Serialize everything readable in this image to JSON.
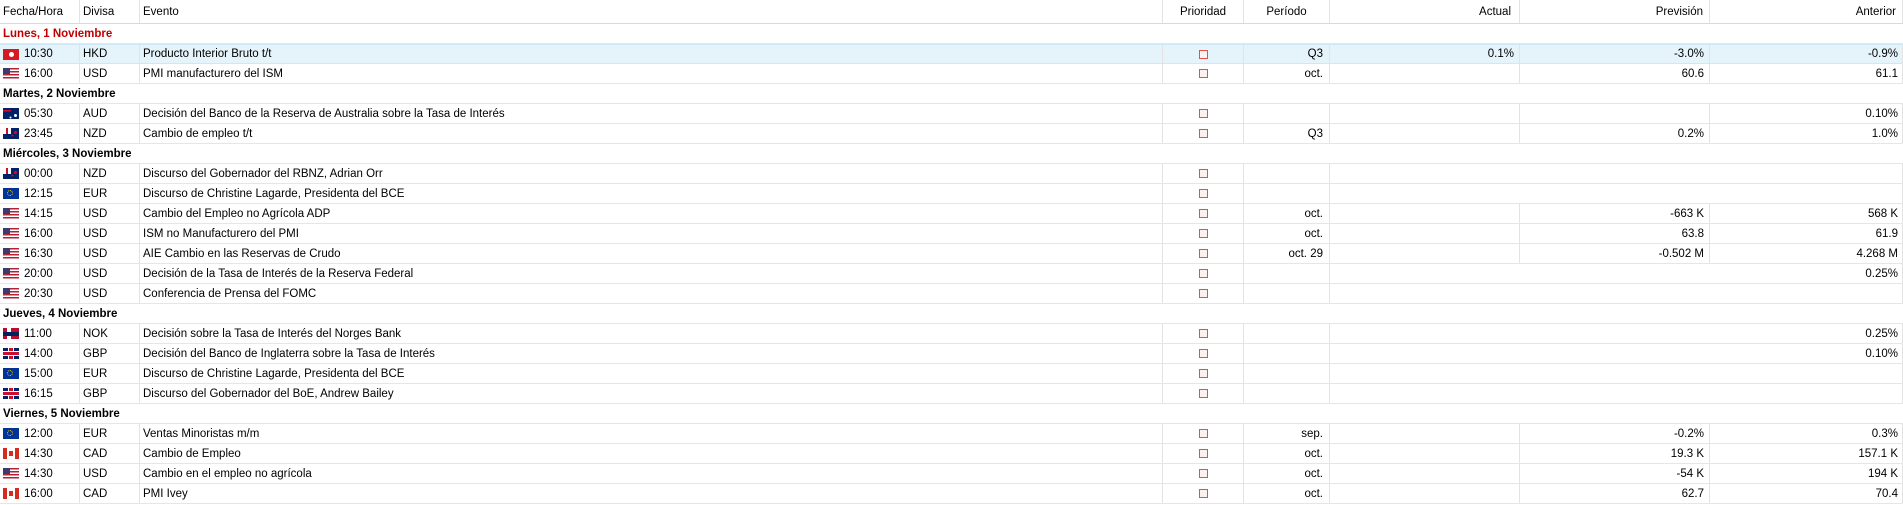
{
  "colors": {
    "day_header": "#c00000",
    "selected_row": "#e5f3fb",
    "priority_box": "#d9534f"
  },
  "columns": {
    "time": "Fecha/Hora",
    "currency": "Divisa",
    "event": "Evento",
    "priority": "Prioridad",
    "period": "Período",
    "actual": "Actual",
    "forecast": "Previsión",
    "previous": "Anterior"
  },
  "days": [
    {
      "label": "Lunes, 1 Noviembre",
      "highlight": true,
      "events": [
        {
          "flag": "hk",
          "time": "10:30",
          "currency": "HKD",
          "event": "Producto Interior Bruto t/t",
          "period": "Q3",
          "actual": "0.1%",
          "forecast": "-3.0%",
          "previous": "-0.9%",
          "selected": true,
          "cells": 5
        },
        {
          "flag": "us",
          "time": "16:00",
          "currency": "USD",
          "event": "PMI manufacturero del ISM",
          "period": "oct.",
          "actual": "",
          "forecast": "60.6",
          "previous": "61.1",
          "cells": 5
        }
      ]
    },
    {
      "label": "Martes, 2 Noviembre",
      "events": [
        {
          "flag": "au",
          "time": "05:30",
          "currency": "AUD",
          "event": "Decisión del Banco de la Reserva de Australia sobre la Tasa de Interés",
          "period": "",
          "actual": "",
          "forecast": "",
          "previous": "0.10%",
          "cells": 5
        },
        {
          "flag": "nz",
          "time": "23:45",
          "currency": "NZD",
          "event": "Cambio de empleo t/t",
          "period": "Q3",
          "actual": "",
          "forecast": "0.2%",
          "previous": "1.0%",
          "cells": 5
        }
      ]
    },
    {
      "label": "Miércoles, 3 Noviembre",
      "events": [
        {
          "flag": "nz",
          "time": "00:00",
          "currency": "NZD",
          "event": "Discurso del Gobernador del RBNZ, Adrian Orr",
          "period": "",
          "actual": "",
          "forecast": "",
          "previous": "",
          "cells": 3
        },
        {
          "flag": "eu",
          "time": "12:15",
          "currency": "EUR",
          "event": "Discurso de Christine Lagarde, Presidenta del BCE",
          "period": "",
          "actual": "",
          "forecast": "",
          "previous": "",
          "cells": 3
        },
        {
          "flag": "us",
          "time": "14:15",
          "currency": "USD",
          "event": "Cambio del Empleo no Agrícola ADP",
          "period": "oct.",
          "actual": "",
          "forecast": "-663 K",
          "previous": "568 K",
          "cells": 5
        },
        {
          "flag": "us",
          "time": "16:00",
          "currency": "USD",
          "event": "ISM no Manufacturero del PMI",
          "period": "oct.",
          "actual": "",
          "forecast": "63.8",
          "previous": "61.9",
          "cells": 5
        },
        {
          "flag": "us",
          "time": "16:30",
          "currency": "USD",
          "event": "AIE Cambio en las Reservas de Crudo",
          "period": "oct. 29",
          "actual": "",
          "forecast": "-0.502 M",
          "previous": "4.268 M",
          "cells": 5
        },
        {
          "flag": "us",
          "time": "20:00",
          "currency": "USD",
          "event": "Decisión de la Tasa de Interés de la Reserva Federal",
          "period": "",
          "actual": "",
          "forecast": "",
          "previous": "0.25%",
          "cells": 4
        },
        {
          "flag": "us",
          "time": "20:30",
          "currency": "USD",
          "event": "Conferencia de Prensa del FOMC",
          "period": "",
          "actual": "",
          "forecast": "",
          "previous": "",
          "cells": 3
        }
      ]
    },
    {
      "label": "Jueves, 4 Noviembre",
      "events": [
        {
          "flag": "no",
          "time": "11:00",
          "currency": "NOK",
          "event": "Decisión sobre la Tasa de Interés del Norges Bank",
          "period": "",
          "actual": "",
          "forecast": "",
          "previous": "0.25%",
          "cells": 4
        },
        {
          "flag": "gb",
          "time": "14:00",
          "currency": "GBP",
          "event": "Decisión del Banco de Inglaterra sobre la Tasa de Interés",
          "period": "",
          "actual": "",
          "forecast": "",
          "previous": "0.10%",
          "cells": 4
        },
        {
          "flag": "eu",
          "time": "15:00",
          "currency": "EUR",
          "event": "Discurso de Christine Lagarde, Presidenta del BCE",
          "period": "",
          "actual": "",
          "forecast": "",
          "previous": "",
          "cells": 3
        },
        {
          "flag": "gb",
          "time": "16:15",
          "currency": "GBP",
          "event": "Discurso del Gobernador del BoE, Andrew Bailey",
          "period": "",
          "actual": "",
          "forecast": "",
          "previous": "",
          "cells": 3
        }
      ]
    },
    {
      "label": "Viernes, 5 Noviembre",
      "events": [
        {
          "flag": "eu",
          "time": "12:00",
          "currency": "EUR",
          "event": "Ventas Minoristas m/m",
          "period": "sep.",
          "actual": "",
          "forecast": "-0.2%",
          "previous": "0.3%",
          "cells": 5
        },
        {
          "flag": "ca",
          "time": "14:30",
          "currency": "CAD",
          "event": "Cambio de Empleo",
          "period": "oct.",
          "actual": "",
          "forecast": "19.3 K",
          "previous": "157.1 K",
          "cells": 5
        },
        {
          "flag": "us",
          "time": "14:30",
          "currency": "USD",
          "event": "Cambio en el empleo no agrícola",
          "period": "oct.",
          "actual": "",
          "forecast": "-54 K",
          "previous": "194 K",
          "cells": 5
        },
        {
          "flag": "ca",
          "time": "16:00",
          "currency": "CAD",
          "event": "PMI Ivey",
          "period": "oct.",
          "actual": "",
          "forecast": "62.7",
          "previous": "70.4",
          "cells": 5
        }
      ]
    }
  ]
}
